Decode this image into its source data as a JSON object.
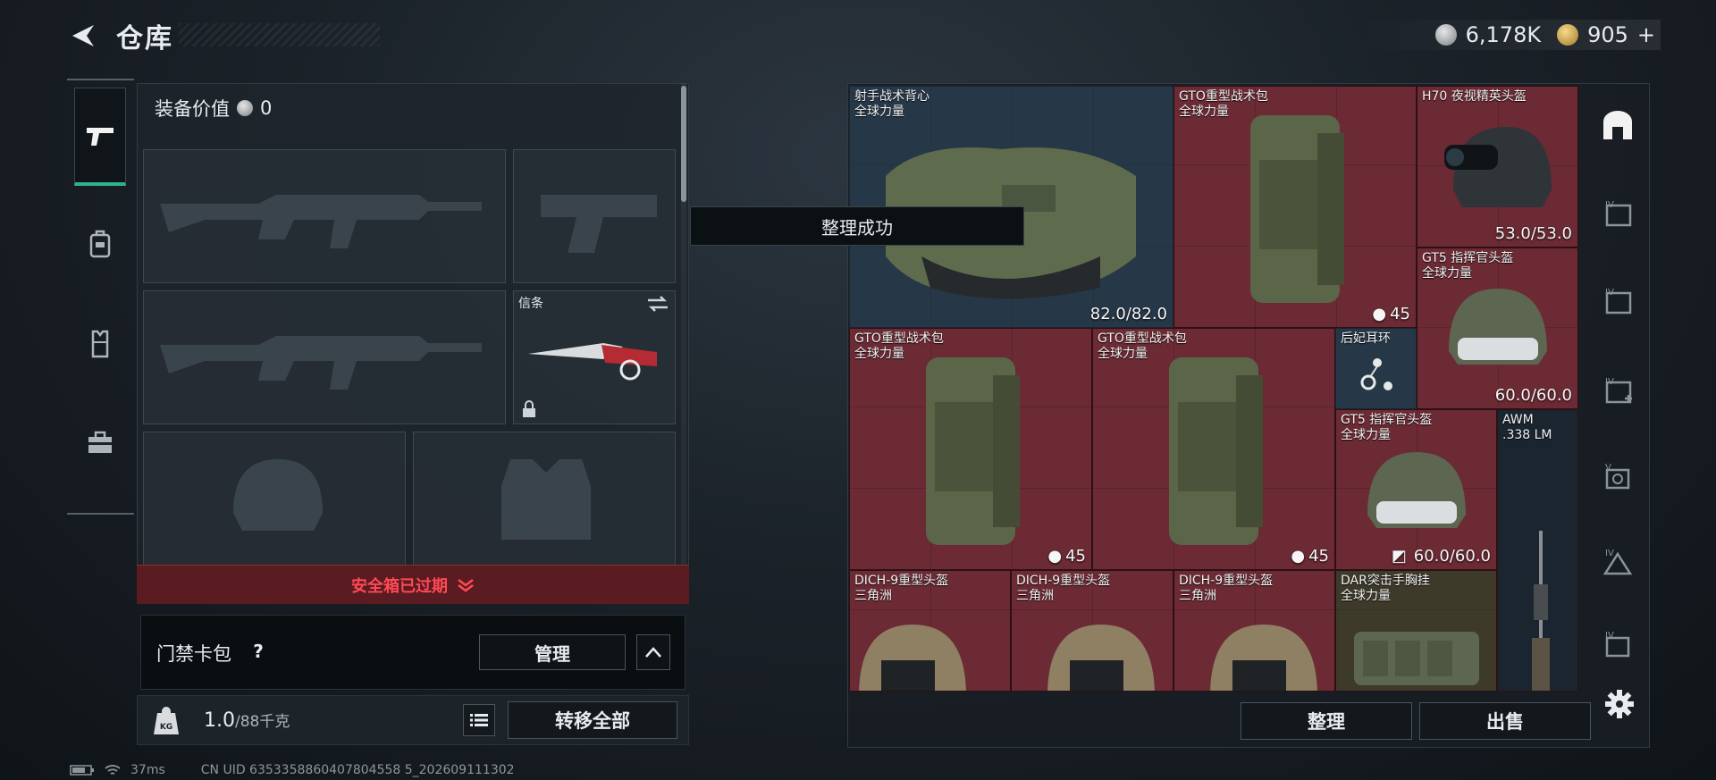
{
  "header": {
    "title": "仓库",
    "currency": [
      {
        "icon": "silver-coin-icon",
        "value": "6,178K"
      },
      {
        "icon": "gold-coin-icon",
        "value": "905"
      }
    ],
    "add_symbol": "+"
  },
  "left_tabs": [
    {
      "icon": "pistol-icon",
      "active": true
    },
    {
      "icon": "backpack-icon",
      "active": false
    },
    {
      "icon": "vest-icon",
      "active": false
    },
    {
      "icon": "toolbox-icon",
      "active": false
    }
  ],
  "equipment": {
    "value_label": "装备价值",
    "value": "0",
    "melee_slot_label": "信条"
  },
  "safe_box": {
    "label": "安全箱已过期"
  },
  "keycard": {
    "label": "门禁卡包",
    "help": "?",
    "manage_label": "管理"
  },
  "weight": {
    "current": "1.0",
    "max": "/88千克"
  },
  "transfer_all_label": "转移全部",
  "toast": "整理成功",
  "inventory": {
    "items": [
      {
        "name": "射手战术背心",
        "sub": "全球力量",
        "value": "82.0/82.0"
      },
      {
        "name": "GTO重型战术包",
        "sub": "全球力量",
        "value": "45"
      },
      {
        "name": "H70 夜视精英头盔",
        "sub": "",
        "value": "53.0/53.0"
      },
      {
        "name": "GT5 指挥官头盔",
        "sub": "全球力量",
        "value": "60.0/60.0"
      },
      {
        "name": "GTO重型战术包",
        "sub": "全球力量",
        "value": "45"
      },
      {
        "name": "GTO重型战术包",
        "sub": "全球力量",
        "value": "45"
      },
      {
        "name": "后妃耳环",
        "sub": "",
        "value": ""
      },
      {
        "name": "GT5 指挥官头盔",
        "sub": "全球力量",
        "value": "60.0/60.0"
      },
      {
        "name": "AWM",
        "sub": ".338 LM",
        "value": ""
      },
      {
        "name": "DICH-9重型头盔",
        "sub": "三角洲",
        "value": ""
      },
      {
        "name": "DICH-9重型头盔",
        "sub": "三角洲",
        "value": ""
      },
      {
        "name": "DICH-9重型头盔",
        "sub": "三角洲",
        "value": ""
      },
      {
        "name": "DAR突击手胸挂",
        "sub": "全球力量",
        "value": ""
      }
    ]
  },
  "sort_label": "整理",
  "sell_label": "出售",
  "filters": [
    "all-items-icon",
    "filter-iv-icon",
    "filter-iv-icon",
    "filter-iv-plus-icon",
    "filter-v-icon",
    "filter-iv-icon",
    "filter-iv-icon"
  ],
  "status": {
    "ping": "37ms",
    "uid": "CN UID 6353358860407804558 5_202609111302"
  },
  "colors": {
    "accent_green": "#2fb38b",
    "rarity_red": "#6b2a34",
    "rarity_blue": "#263848",
    "warning_red": "#ff4a55"
  }
}
